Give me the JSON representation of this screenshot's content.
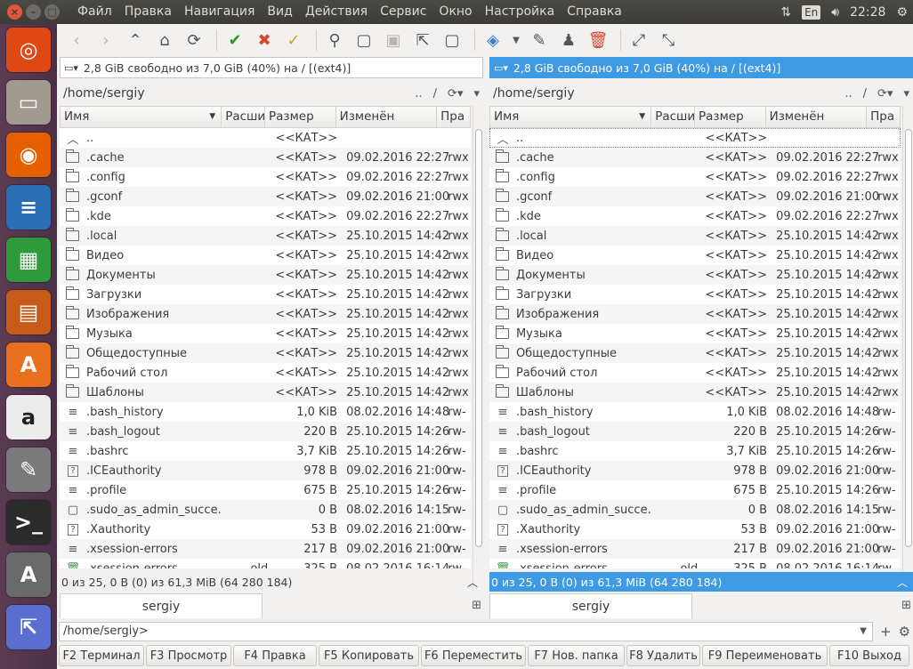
{
  "menu": [
    "Файл",
    "Правка",
    "Навигация",
    "Вид",
    "Действия",
    "Сервис",
    "Окно",
    "Настройка",
    "Справка"
  ],
  "tray": {
    "lang": "En",
    "time": "22:28"
  },
  "launcher": [
    "ubuntu-icon",
    "files-icon",
    "firefox-icon",
    "writer-icon",
    "calc-icon",
    "impress-icon",
    "software-center-icon",
    "amazon-icon",
    "settings-icon",
    "terminal-icon",
    "updater-icon",
    "krusader-icon"
  ],
  "left": {
    "disk": "2,8 GiB свободно из 7,0 GiB (40%) на / [(ext4)]",
    "path": "/home/sergiy",
    "path_ctrl": [
      "..",
      "/",
      "⟳▾",
      "▾"
    ],
    "status": "0 из 25, 0 B (0) из 61,3 MiB (64 280 184)",
    "tab": "sergiy"
  },
  "right": {
    "disk": "2,8 GiB свободно из 7,0 GiB (40%) на / [(ext4)]",
    "path": "/home/sergiy",
    "path_ctrl": [
      "..",
      "/",
      "⟳▾",
      "▾"
    ],
    "status": "0 из 25, 0 B (0) из 61,3 MiB (64 280 184)",
    "tab": "sergiy"
  },
  "columns": [
    "Имя",
    "Расши",
    "Размер",
    "Изменён",
    "Пра"
  ],
  "rows": [
    {
      "icon": "up",
      "name": "..",
      "ext": "",
      "size": "<<КАТ>>",
      "date": "",
      "attr": ""
    },
    {
      "icon": "folder",
      "name": ".cache",
      "ext": "",
      "size": "<<КАТ>>",
      "date": "09.02.2016 22:27",
      "attr": "rwx"
    },
    {
      "icon": "folder",
      "name": ".config",
      "ext": "",
      "size": "<<КАТ>>",
      "date": "09.02.2016 22:27",
      "attr": "rwx"
    },
    {
      "icon": "folder",
      "name": ".gconf",
      "ext": "",
      "size": "<<КАТ>>",
      "date": "09.02.2016 21:00",
      "attr": "rwx"
    },
    {
      "icon": "folder",
      "name": ".kde",
      "ext": "",
      "size": "<<КАТ>>",
      "date": "09.02.2016 22:27",
      "attr": "rwx"
    },
    {
      "icon": "folder",
      "name": ".local",
      "ext": "",
      "size": "<<КАТ>>",
      "date": "25.10.2015 14:42",
      "attr": "rwx"
    },
    {
      "icon": "folder",
      "name": "Видео",
      "ext": "",
      "size": "<<КАТ>>",
      "date": "25.10.2015 14:42",
      "attr": "rwx"
    },
    {
      "icon": "folder",
      "name": "Документы",
      "ext": "",
      "size": "<<КАТ>>",
      "date": "25.10.2015 14:42",
      "attr": "rwx"
    },
    {
      "icon": "folder",
      "name": "Загрузки",
      "ext": "",
      "size": "<<КАТ>>",
      "date": "25.10.2015 14:42",
      "attr": "rwx"
    },
    {
      "icon": "folder",
      "name": "Изображения",
      "ext": "",
      "size": "<<КАТ>>",
      "date": "25.10.2015 14:42",
      "attr": "rwx"
    },
    {
      "icon": "folder",
      "name": "Музыка",
      "ext": "",
      "size": "<<КАТ>>",
      "date": "25.10.2015 14:42",
      "attr": "rwx"
    },
    {
      "icon": "folder",
      "name": "Общедоступные",
      "ext": "",
      "size": "<<КАТ>>",
      "date": "25.10.2015 14:42",
      "attr": "rwx"
    },
    {
      "icon": "folder",
      "name": "Рабочий стол",
      "ext": "",
      "size": "<<КАТ>>",
      "date": "25.10.2015 14:42",
      "attr": "rwx"
    },
    {
      "icon": "folder",
      "name": "Шаблоны",
      "ext": "",
      "size": "<<КАТ>>",
      "date": "25.10.2015 14:42",
      "attr": "rwx"
    },
    {
      "icon": "text",
      "name": ".bash_history",
      "ext": "",
      "size": "1,0 KiB",
      "date": "08.02.2016 14:48",
      "attr": "rw-"
    },
    {
      "icon": "text",
      "name": ".bash_logout",
      "ext": "",
      "size": "220 B",
      "date": "25.10.2015 14:26",
      "attr": "rw-"
    },
    {
      "icon": "text",
      "name": ".bashrc",
      "ext": "",
      "size": "3,7 KiB",
      "date": "25.10.2015 14:26",
      "attr": "rw-"
    },
    {
      "icon": "unknown",
      "name": ".ICEauthority",
      "ext": "",
      "size": "978 B",
      "date": "09.02.2016 21:00",
      "attr": "rw-"
    },
    {
      "icon": "text",
      "name": ".profile",
      "ext": "",
      "size": "675 B",
      "date": "25.10.2015 14:26",
      "attr": "rw-"
    },
    {
      "icon": "empty",
      "name": ".sudo_as_admin_succe...",
      "ext": "",
      "size": "0 B",
      "date": "08.02.2016 14:15",
      "attr": "rw-"
    },
    {
      "icon": "unknown",
      "name": ".Xauthority",
      "ext": "",
      "size": "53 B",
      "date": "09.02.2016 21:00",
      "attr": "rw-"
    },
    {
      "icon": "text",
      "name": ".xsession-errors",
      "ext": "",
      "size": "217 B",
      "date": "09.02.2016 21:00",
      "attr": "rw-"
    },
    {
      "icon": "trash",
      "name": ".xsession-errors",
      "ext": "old",
      "size": "325 B",
      "date": "08.02.2016 16:14",
      "attr": "rw-"
    }
  ],
  "cmdline": "/home/sergiy>",
  "fkeys": [
    {
      "k": "F2",
      "l": "Терминал"
    },
    {
      "k": "F3",
      "l": "Просмотр"
    },
    {
      "k": "F4",
      "l": "Правка"
    },
    {
      "k": "F5",
      "l": "Копировать"
    },
    {
      "k": "F6",
      "l": "Переместить"
    },
    {
      "k": "F7",
      "l": "Нов. папка"
    },
    {
      "k": "F8",
      "l": "Удалить"
    },
    {
      "k": "F9",
      "l": "Переименовать"
    },
    {
      "k": "F10",
      "l": "Выход"
    }
  ],
  "colors": {
    "accent": "#3d9ae3",
    "topbar": "#3c3b37",
    "launcher": "#4b3047"
  }
}
